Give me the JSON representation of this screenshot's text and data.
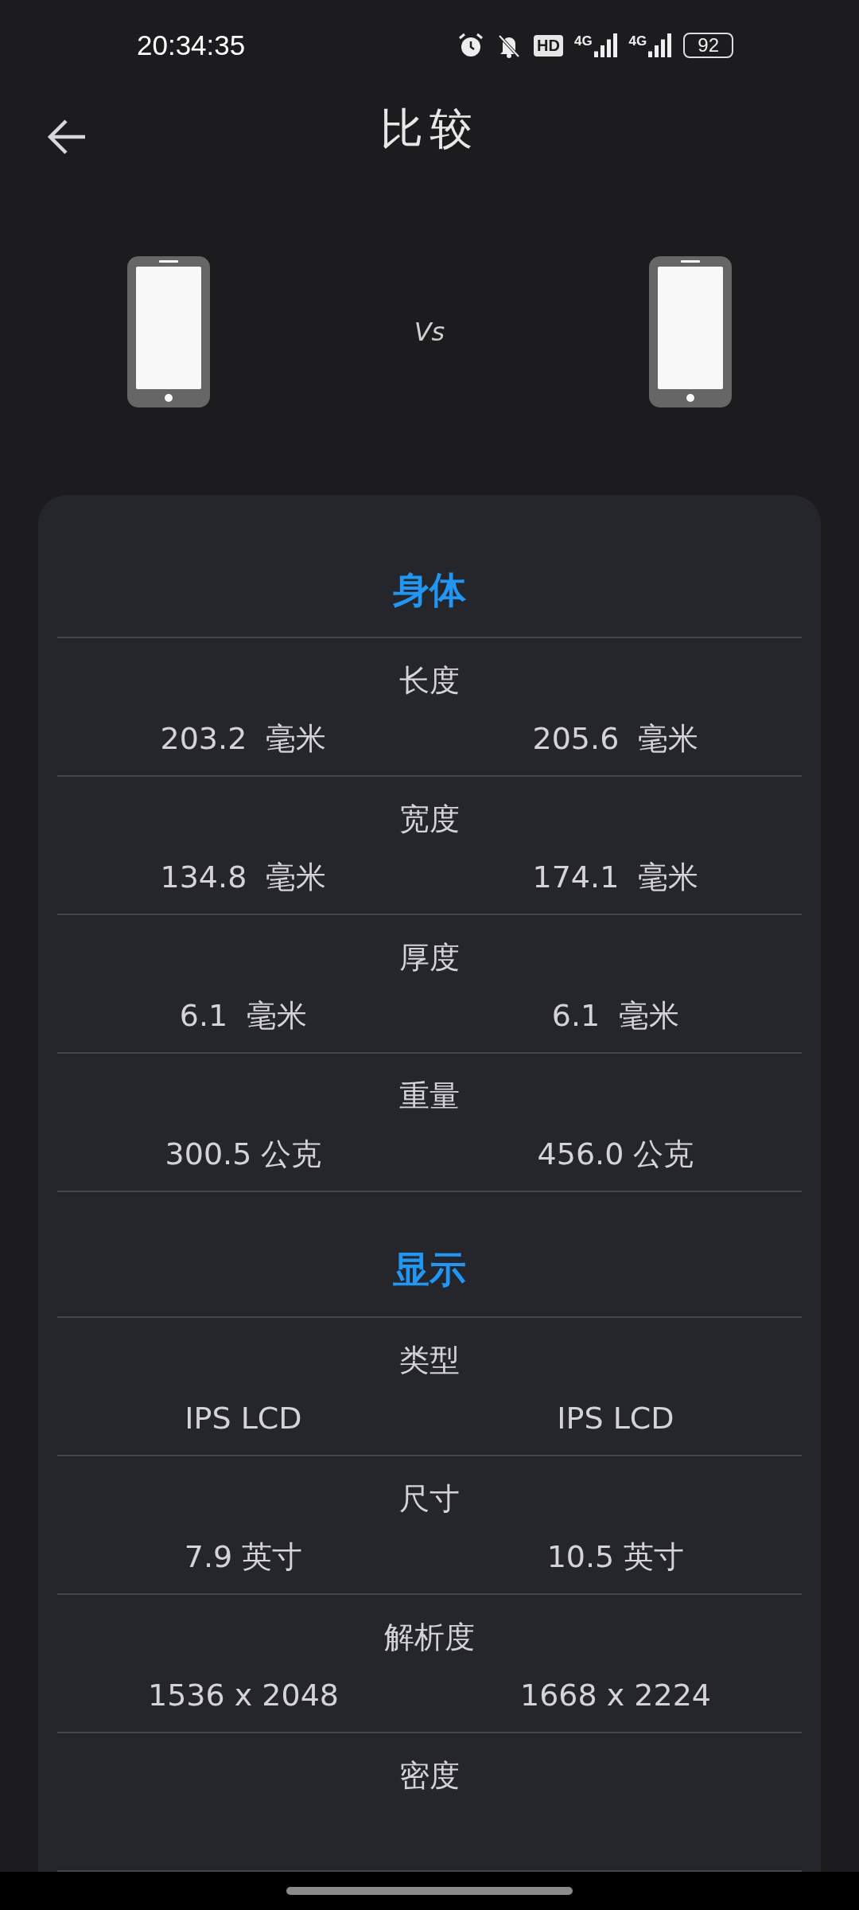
{
  "status_bar": {
    "time": "20:34:35",
    "hd_label": "HD",
    "networks": [
      "4G",
      "4G"
    ],
    "battery": "92"
  },
  "header": {
    "title": "比较"
  },
  "compare": {
    "vs": "Vs"
  },
  "sections": [
    {
      "title": "身体",
      "rows": [
        {
          "label": "长度",
          "left": "203.2  毫米",
          "right": "205.6  毫米"
        },
        {
          "label": "宽度",
          "left": "134.8  毫米",
          "right": "174.1  毫米"
        },
        {
          "label": "厚度",
          "left": "6.1  毫米",
          "right": "6.1  毫米"
        },
        {
          "label": "重量",
          "left": "300.5 公克",
          "right": "456.0 公克"
        }
      ]
    },
    {
      "title": "显示",
      "rows": [
        {
          "label": "类型",
          "left": "IPS LCD",
          "right": "IPS LCD"
        },
        {
          "label": "尺寸",
          "left": "7.9 英寸",
          "right": "10.5 英寸"
        },
        {
          "label": "解析度",
          "left": "1536 x 2048",
          "right": "1668 x 2224"
        },
        {
          "label": "密度"
        }
      ]
    }
  ]
}
